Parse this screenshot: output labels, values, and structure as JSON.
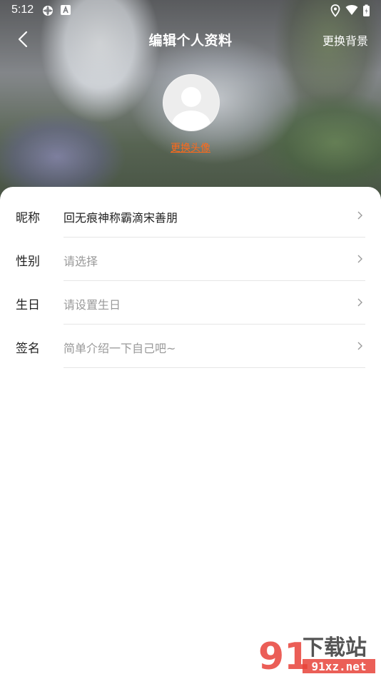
{
  "status_bar": {
    "time": "5:12",
    "left_icons": [
      "settings-icon",
      "keyboard-icon"
    ],
    "right_icons": [
      "location-icon",
      "wifi-icon",
      "battery-icon"
    ]
  },
  "header": {
    "title": "编辑个人资料",
    "back_icon": "back-arrow-icon",
    "change_background_label": "更换背景"
  },
  "avatar": {
    "icon": "default-avatar-icon",
    "change_label": "更换头像",
    "change_color": "#ff6a1a"
  },
  "form": {
    "rows": [
      {
        "label": "昵称",
        "value": "回无痕神称霸滴宋善朋",
        "placeholder": false
      },
      {
        "label": "性别",
        "value": "请选择",
        "placeholder": true
      },
      {
        "label": "生日",
        "value": "请设置生日",
        "placeholder": true
      },
      {
        "label": "签名",
        "value": "简单介绍一下自己吧~",
        "placeholder": true
      }
    ]
  },
  "watermark": {
    "logo_text": "91",
    "title": "下载站",
    "url": "91xz.net"
  }
}
